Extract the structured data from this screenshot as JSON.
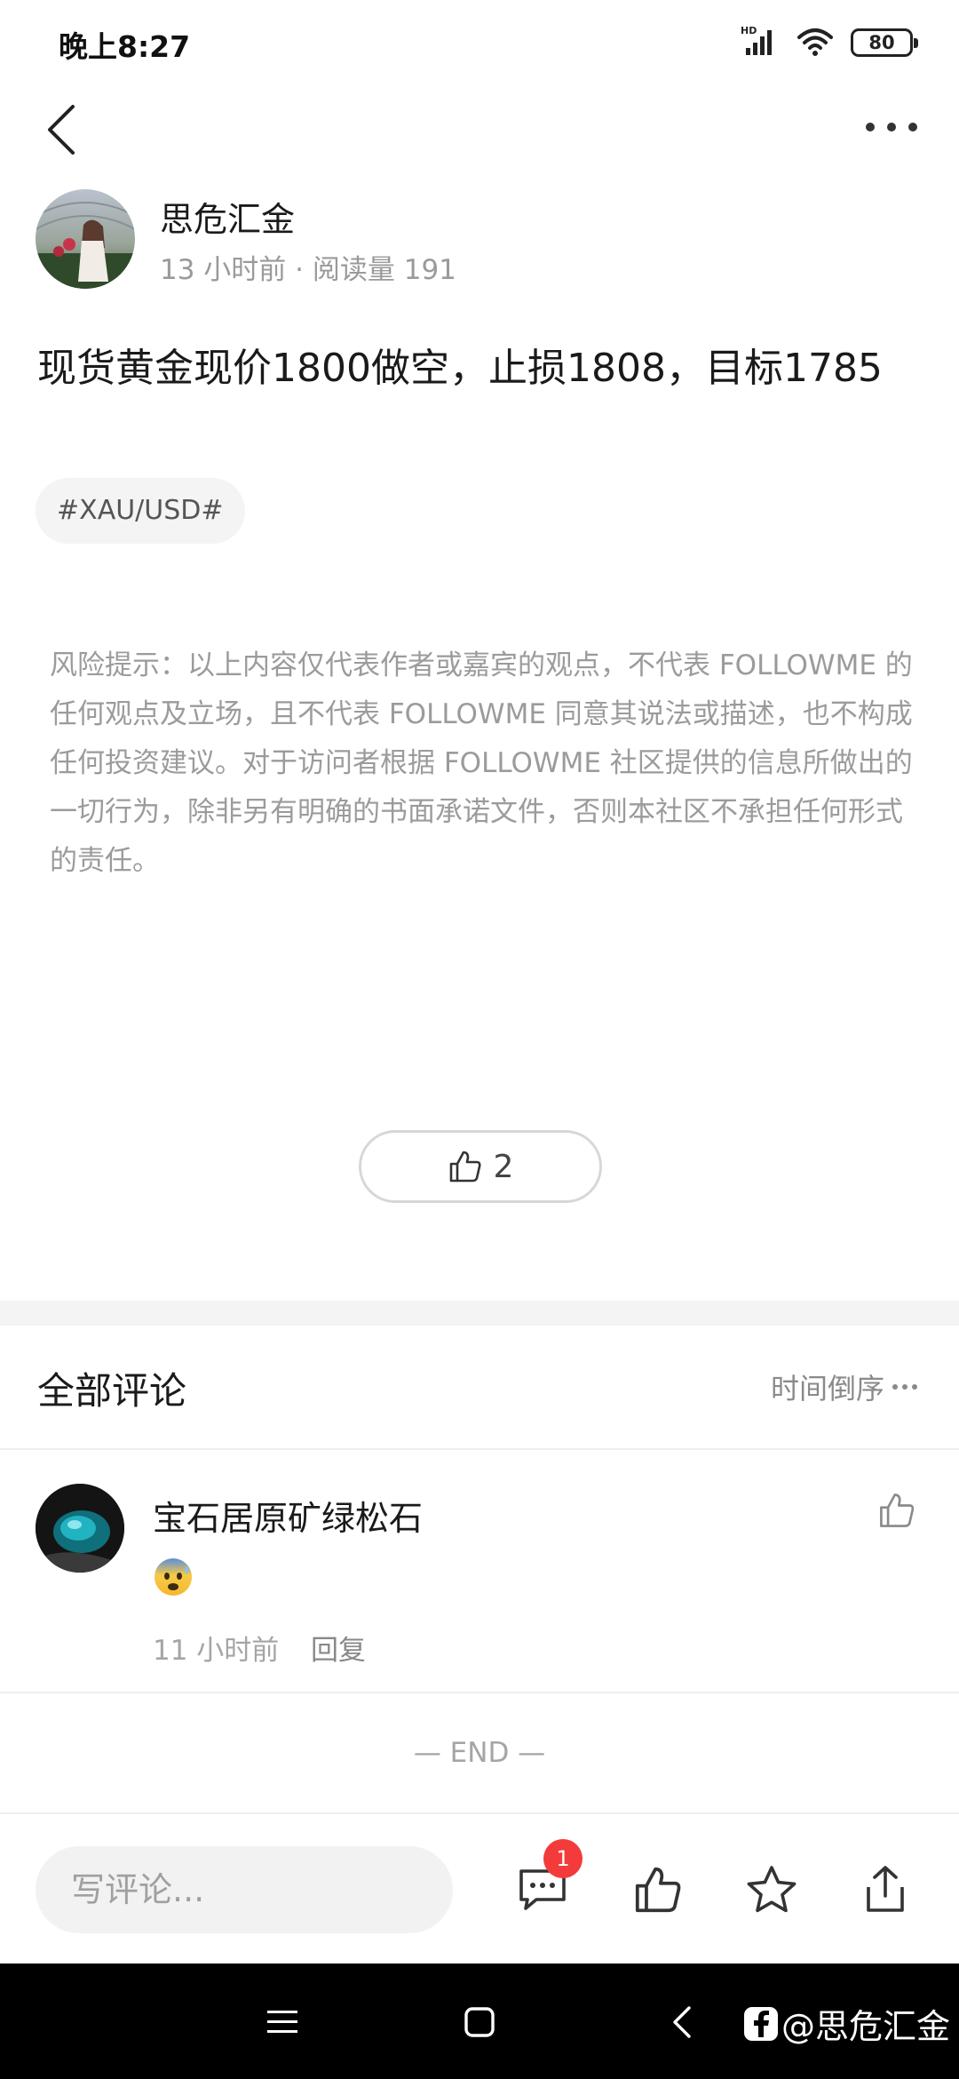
{
  "status_bar": {
    "time": "晚上8:27",
    "battery": "80",
    "network_label": "HD"
  },
  "post": {
    "author_name": "思危汇金",
    "meta": "13 小时前 · 阅读量 191",
    "title": "现货黄金现价1800做空，止损1808，目标1785",
    "tag": "#XAU/USD#",
    "disclaimer": "风险提示：以上内容仅代表作者或嘉宾的观点，不代表 FOLLOWME 的任何观点及立场，且不代表 FOLLOWME 同意其说法或描述，也不构成任何投资建议。对于访问者根据 FOLLOWME 社区提供的信息所做出的一切行为，除非另有明确的书面承诺文件，否则本社区不承担任何形式的责任。",
    "like_count": "2"
  },
  "comments": {
    "title": "全部评论",
    "sort_label": "时间倒序",
    "items": [
      {
        "author": "宝石居原矿绿松石",
        "time": "11 小时前",
        "reply_label": "回复"
      }
    ],
    "end_label": "— END —"
  },
  "bottom_bar": {
    "input_placeholder": "写评论...",
    "comment_badge": "1"
  },
  "watermark": {
    "text": "@思危汇金"
  },
  "colors": {
    "badge": "#f33b3b",
    "muted_text": "#9b9b9b",
    "divider": "#efefef"
  }
}
